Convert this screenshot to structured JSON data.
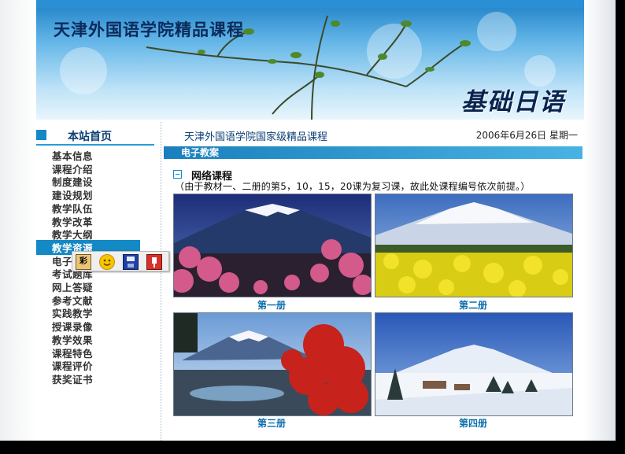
{
  "banner": {
    "site_title": "天津外国语学院精品课程",
    "course_title": "基础日语"
  },
  "subbar": {
    "home_label": "本站首页",
    "marquee_text": "天津外国语学院国家级精品课程",
    "date_text": "2006年6月26日  星期一"
  },
  "nav": {
    "items": [
      {
        "label": "基本信息"
      },
      {
        "label": "课程介绍"
      },
      {
        "label": "制度建设"
      },
      {
        "label": "建设规划"
      },
      {
        "label": "教学队伍"
      },
      {
        "label": "教学改革"
      },
      {
        "label": "教学大纲"
      },
      {
        "label": "教学资源",
        "active": true
      },
      {
        "label": "电子教案"
      },
      {
        "label": "考试题库"
      },
      {
        "label": "网上答疑"
      },
      {
        "label": "参考文献"
      },
      {
        "label": "实践教学"
      },
      {
        "label": "授课录像"
      },
      {
        "label": "教学效果"
      },
      {
        "label": "课程特色"
      },
      {
        "label": "课程评价"
      },
      {
        "label": "获奖证书"
      }
    ]
  },
  "content": {
    "section_title": "电子教案",
    "net_title": "网络课程",
    "note": "（由于教材一、二册的第5，10，15，20课为复习课，故此处课程编号依次前提。）",
    "volumes": [
      {
        "caption": "第一册",
        "scene": "fuji-cherry-blossoms"
      },
      {
        "caption": "第二册",
        "scene": "fuji-rapeseed-field"
      },
      {
        "caption": "第三册",
        "scene": "fuji-autumn-maple"
      },
      {
        "caption": "第四册",
        "scene": "fuji-winter-snow"
      }
    ]
  },
  "floating_toolbar": {
    "buttons": [
      {
        "icon": "color-palette-icon",
        "text": "彩"
      },
      {
        "icon": "smiley-icon"
      },
      {
        "icon": "save-icon"
      },
      {
        "icon": "pin-icon"
      }
    ]
  },
  "colors": {
    "accent": "#1389c5",
    "nav_text": "#333333",
    "caption": "#0d6fae"
  }
}
